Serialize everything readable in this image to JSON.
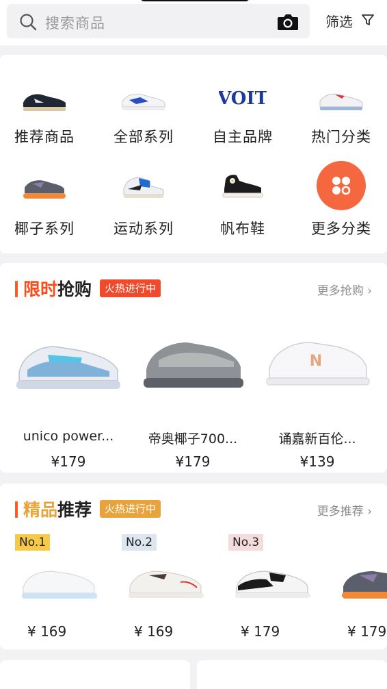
{
  "search": {
    "placeholder": "搜索商品",
    "filter_label": "筛选"
  },
  "categories": [
    {
      "label": "推荐商品",
      "icon": "sneaker-black-white"
    },
    {
      "label": "全部系列",
      "icon": "sneaker-white-blue"
    },
    {
      "label": "自主品牌",
      "icon": "voit-logo",
      "logo_text": "VOIT"
    },
    {
      "label": "热门分类",
      "icon": "sneaker-white-red"
    },
    {
      "label": "椰子系列",
      "icon": "sneaker-grey-orange"
    },
    {
      "label": "运动系列",
      "icon": "sneaker-blue-white"
    },
    {
      "label": "帆布鞋",
      "icon": "canvas-shoe-black"
    },
    {
      "label": "更多分类",
      "icon": "more-categories-icon"
    }
  ],
  "flash_sale": {
    "title_accent": "限时",
    "title_rest": "抢购",
    "badge": "火热进行中",
    "more": "更多抢购",
    "products": [
      {
        "name": "unico power...",
        "price": "¥179"
      },
      {
        "name": "帝奥椰子700...",
        "price": "¥179"
      },
      {
        "name": "诵嘉新百伦...",
        "price": "¥139"
      }
    ]
  },
  "recommend": {
    "title_accent": "精品",
    "title_rest": "推荐",
    "badge": "火热进行中",
    "more": "更多推荐",
    "products": [
      {
        "rank": "No.1",
        "price": "¥ 169"
      },
      {
        "rank": "No.2",
        "price": "¥ 169"
      },
      {
        "rank": "No.3",
        "price": "¥ 179"
      },
      {
        "rank": "",
        "price": "¥ 179"
      }
    ]
  },
  "colors": {
    "accent_orange": "#ff4a1a",
    "badge_red": "#f04a2c",
    "badge_gold": "#e8a33a",
    "rank1_bg": "#f7c948",
    "rank2_bg": "#dde6ef",
    "rank3_bg": "#f4dcdc"
  }
}
